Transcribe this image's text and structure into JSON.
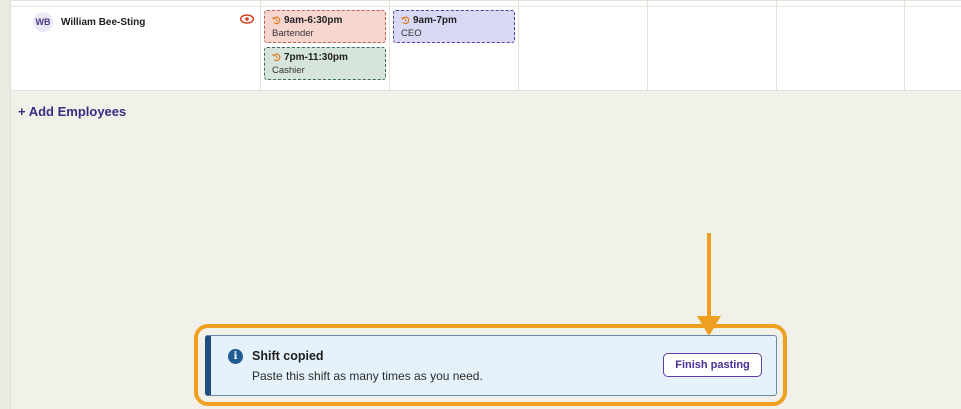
{
  "employee": {
    "initials": "WB",
    "name": "William Bee-Sting"
  },
  "shifts": [
    {
      "time": "9am-6:30pm",
      "role": "Bartender",
      "color": "#f8d6d0"
    },
    {
      "time": "9am-7pm",
      "role": "CEO",
      "color": "#d9d8f5"
    },
    {
      "time": "7pm-11:30pm",
      "role": "Cashier",
      "color": "#d6e5dc"
    }
  ],
  "add_employees_label": "+ Add Employees",
  "toast": {
    "title": "Shift copied",
    "message": "Paste this shift as many times as you need.",
    "button_label": "Finish pasting"
  },
  "colors": {
    "highlight": "#f0a020",
    "brand_purple": "#4a2f97",
    "info_blue": "#1f5c93"
  }
}
